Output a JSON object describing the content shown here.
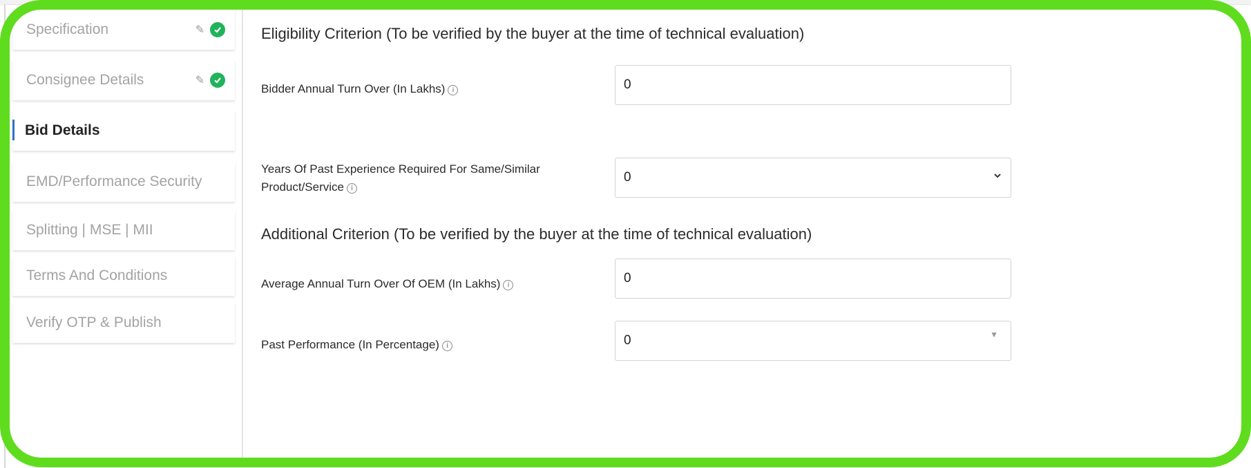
{
  "sidebar": {
    "items": [
      {
        "label": "Specification"
      },
      {
        "label": "Consignee Details"
      },
      {
        "label": "Bid Details"
      },
      {
        "label": "EMD/Performance Security"
      },
      {
        "label": "Splitting | MSE | MII"
      },
      {
        "label": "Terms And Conditions"
      },
      {
        "label": "Verify OTP & Publish"
      }
    ]
  },
  "main": {
    "eligibility_heading": "Eligibility Criterion (To be verified by the buyer at the time of technical evaluation)",
    "additional_heading": "Additional Criterion (To be verified by the buyer at the time of technical evaluation)",
    "fields": {
      "turnover": {
        "label": "Bidder Annual Turn Over (In Lakhs)",
        "value": "0"
      },
      "experience": {
        "label_line1": "Years Of Past Experience Required For Same/Similar",
        "label_line2": "Product/Service",
        "value": "0"
      },
      "oem_turnover": {
        "label": "Average Annual Turn Over Of OEM (In Lakhs)",
        "value": "0"
      },
      "past_performance": {
        "label": "Past Performance (In Percentage)",
        "value": "0"
      }
    },
    "info_glyph": "i"
  },
  "colors": {
    "frame": "#5fdc1e",
    "check": "#20b35c",
    "active_bar": "#2f73c8"
  }
}
